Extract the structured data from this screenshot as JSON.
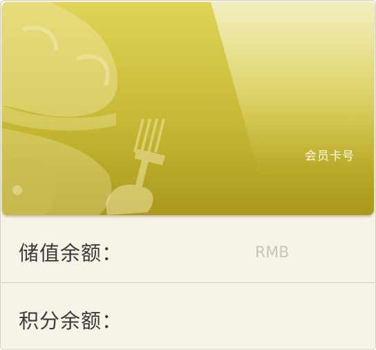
{
  "card": {
    "label": "会员卡号",
    "colors": {
      "primary": "#c9bc3a",
      "light": "#e0d55a",
      "dark": "#ad9b1e",
      "shine": "#f1edbb"
    }
  },
  "balance": {
    "label": "储值余额：",
    "unit": "RMB"
  },
  "points": {
    "label": "积分余额："
  },
  "icons": [
    "chef-hat-icon",
    "fork-icon"
  ]
}
